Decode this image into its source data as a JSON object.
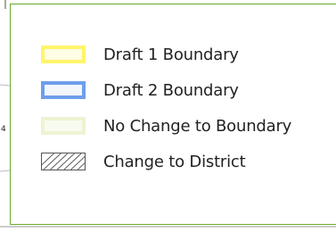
{
  "map": {
    "edge_label": "4"
  },
  "legend": {
    "border_color": "#6aaa2a",
    "items": [
      {
        "label": "Draft 1 Boundary",
        "swatch": "yellow-outline",
        "color": "#fff56a"
      },
      {
        "label": "Draft 2 Boundary",
        "swatch": "blue-outline",
        "color": "#6f9fea"
      },
      {
        "label": "No Change to Boundary",
        "swatch": "pale-green-outline",
        "color": "#eef3d2"
      },
      {
        "label": "Change to District",
        "swatch": "diagonal-hatch",
        "color": "#555555"
      }
    ]
  }
}
